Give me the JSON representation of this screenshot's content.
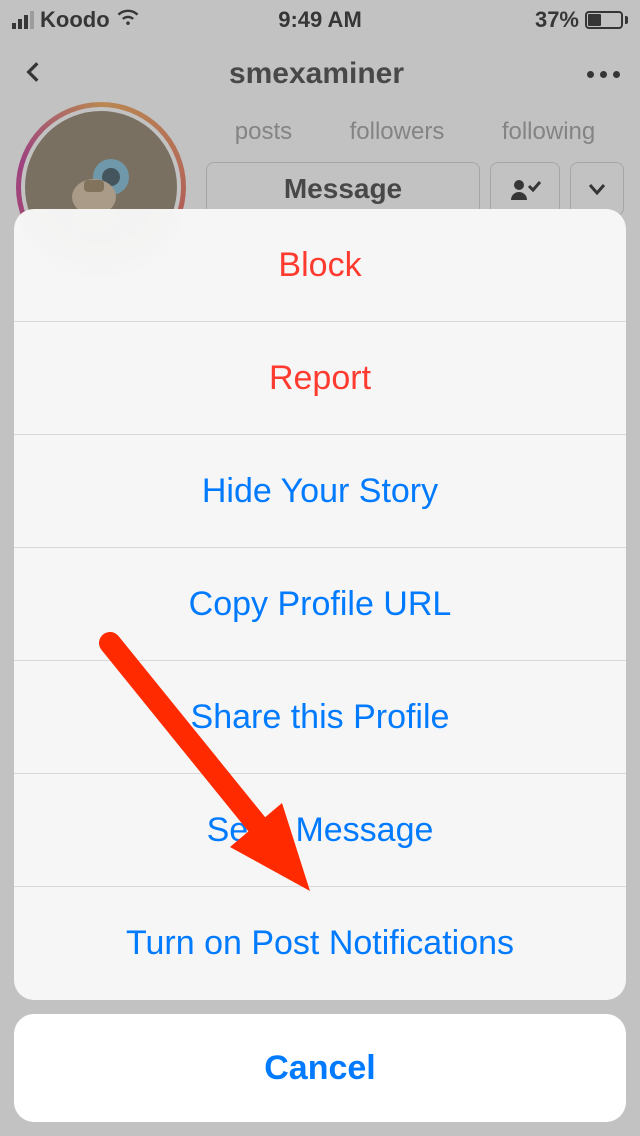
{
  "status_bar": {
    "carrier": "Koodo",
    "time": "9:49 AM",
    "battery_percent": "37%"
  },
  "header": {
    "title": "smexaminer"
  },
  "profile": {
    "stats": {
      "posts": "posts",
      "followers": "followers",
      "following": "following"
    },
    "message_button": "Message"
  },
  "action_sheet": {
    "items": [
      {
        "label": "Block",
        "style": "destructive"
      },
      {
        "label": "Report",
        "style": "destructive"
      },
      {
        "label": "Hide Your Story",
        "style": "normal"
      },
      {
        "label": "Copy Profile URL",
        "style": "normal"
      },
      {
        "label": "Share this Profile",
        "style": "normal"
      },
      {
        "label": "Send Message",
        "style": "normal"
      },
      {
        "label": "Turn on Post Notifications",
        "style": "normal"
      }
    ],
    "cancel": "Cancel"
  }
}
